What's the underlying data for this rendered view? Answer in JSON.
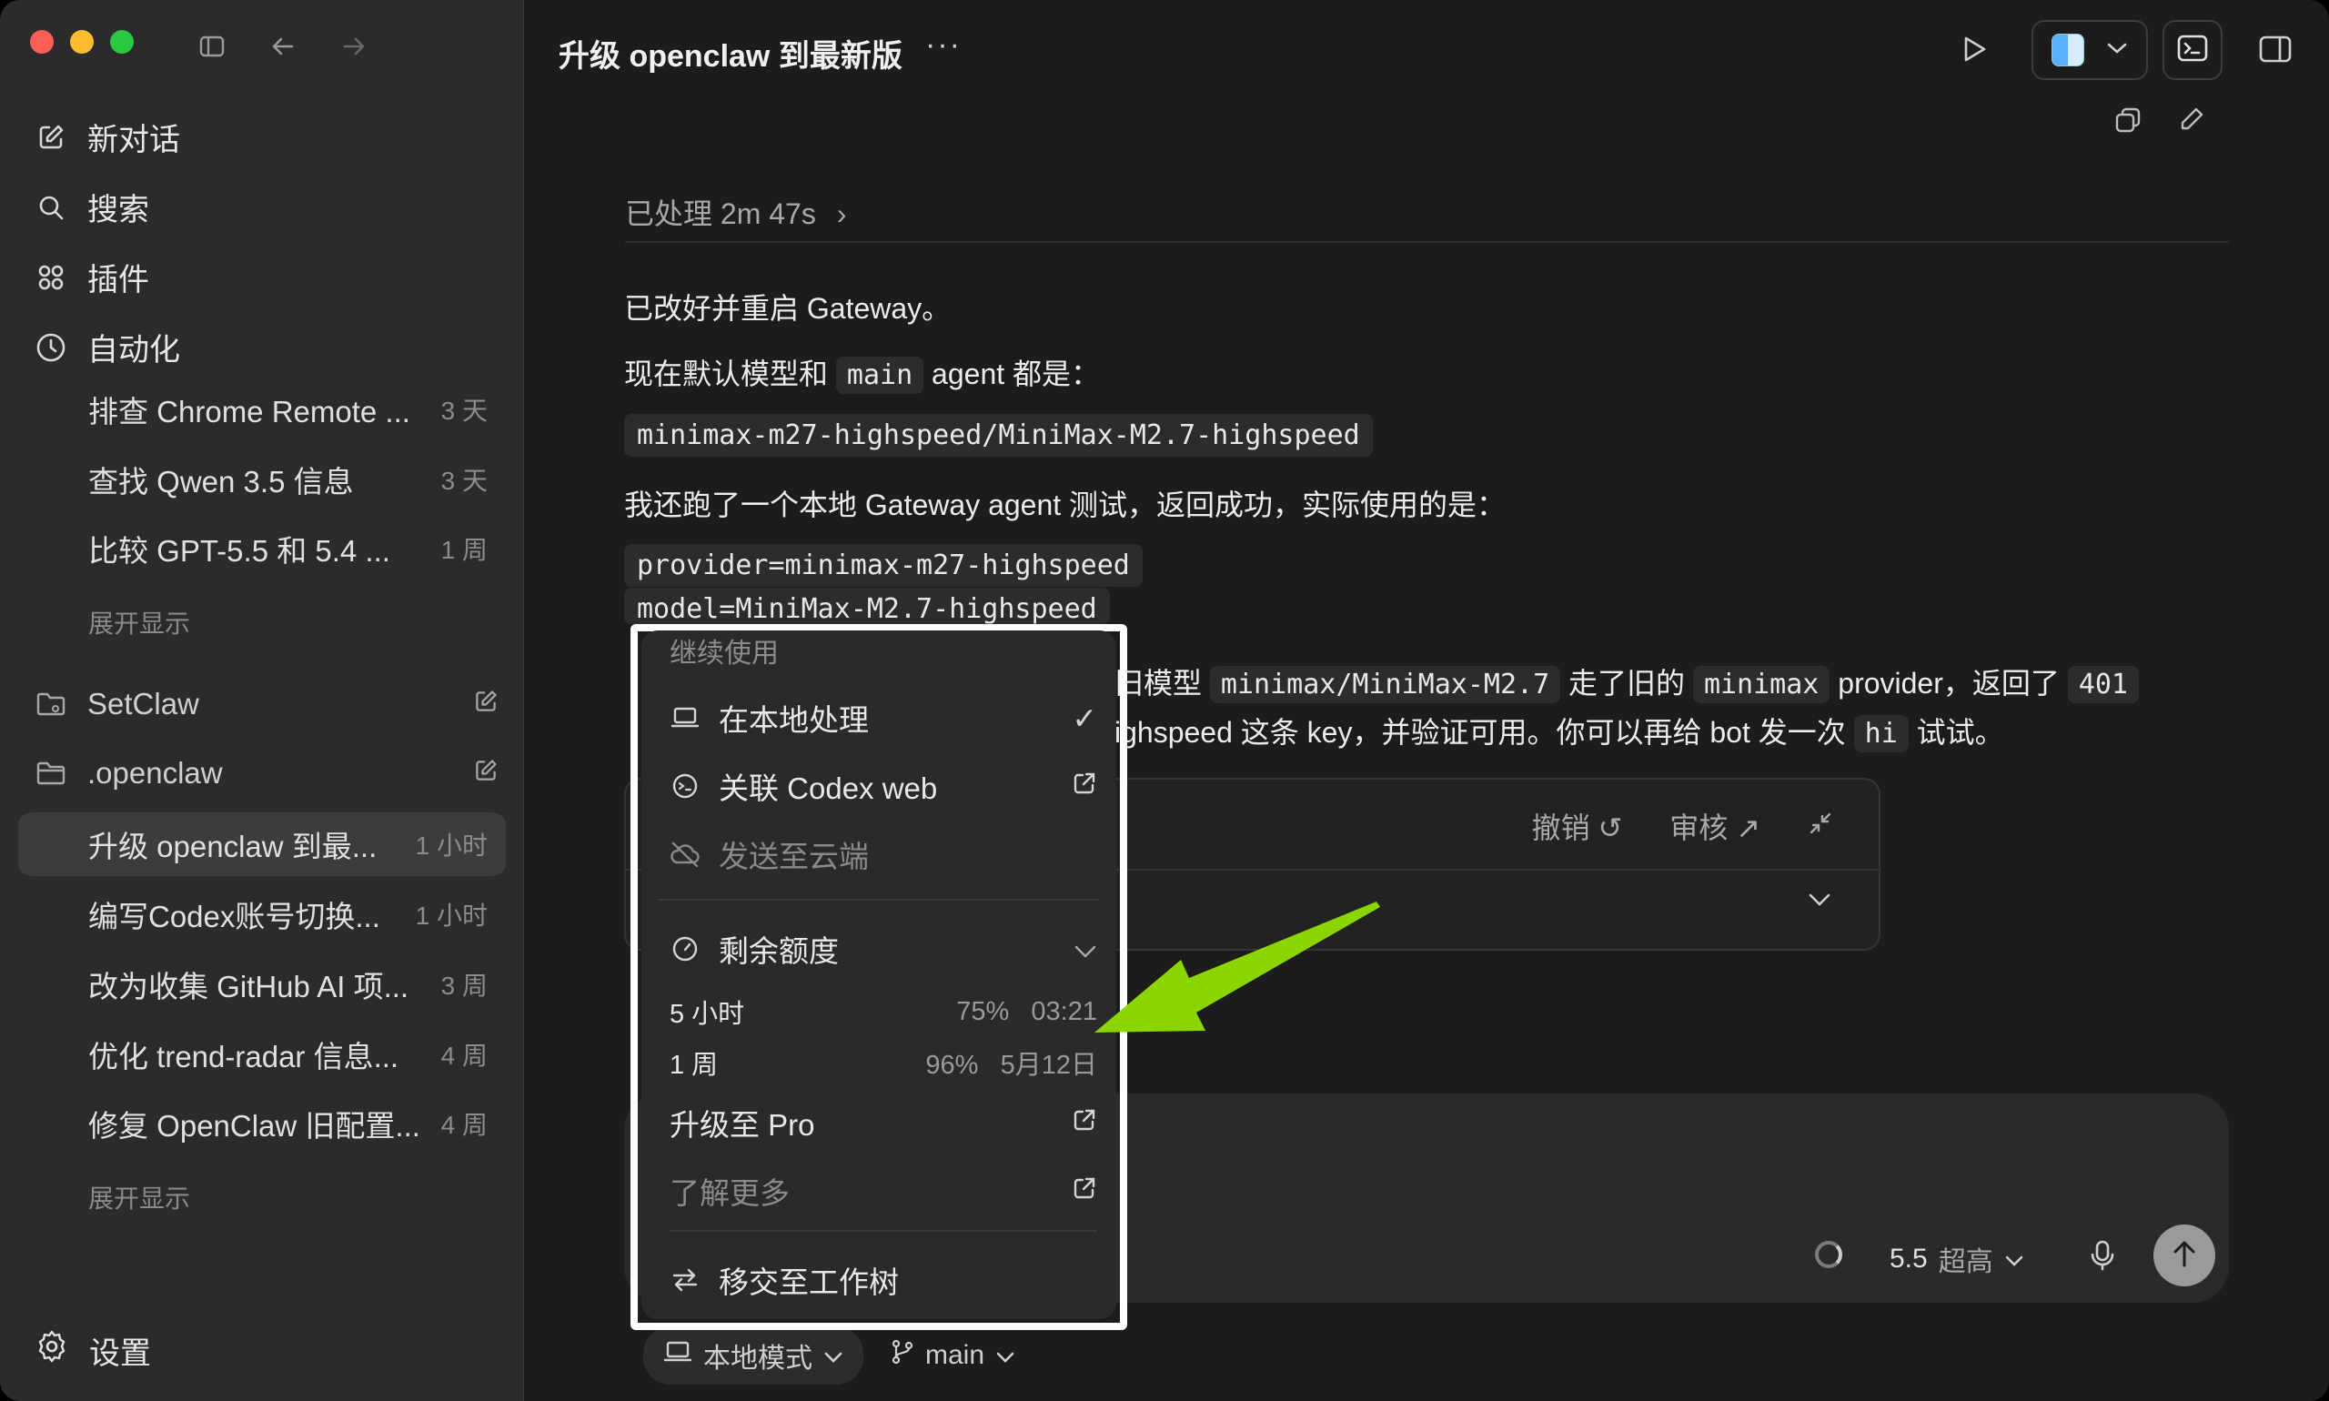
{
  "sidebar": {
    "nav": [
      {
        "label": "新对话",
        "icon": "compose-icon"
      },
      {
        "label": "搜索",
        "icon": "search-icon"
      },
      {
        "label": "插件",
        "icon": "plugins-icon"
      },
      {
        "label": "自动化",
        "icon": "clock-icon"
      }
    ],
    "recent": [
      {
        "title": "排查 Chrome Remote ...",
        "time": "3 天"
      },
      {
        "title": "查找 Qwen 3.5 信息",
        "time": "3 天"
      },
      {
        "title": "比较 GPT-5.5 和 5.4 ...",
        "time": "1 周"
      }
    ],
    "show_more_1": "展开显示",
    "projects": [
      {
        "label": "SetClaw"
      },
      {
        "label": ".openclaw"
      }
    ],
    "threads": [
      {
        "title": "升级 openclaw 到最...",
        "time": "1 小时"
      },
      {
        "title": "编写Codex账号切换...",
        "time": "1 小时"
      },
      {
        "title": "改为收集 GitHub AI 项...",
        "time": "3 周"
      },
      {
        "title": "优化 trend-radar 信息...",
        "time": "4 周"
      },
      {
        "title": "修复 OpenClaw 旧配置...",
        "time": "4 周"
      }
    ],
    "show_more_2": "展开显示",
    "settings": "设置"
  },
  "header": {
    "title": "升级 openclaw 到最新版",
    "more": "···"
  },
  "message": {
    "processed": "已处理 2m 47s",
    "line1": "已改好并重启 Gateway。",
    "line2_pre": "现在默认模型和",
    "line2_code": "main",
    "line2_post": "agent 都是：",
    "code1": "minimax-m27-highspeed/MiniMax-M2.7-highspeed",
    "line3": "我还跑了一个本地 Gateway agent 测试，返回成功，实际使用的是：",
    "code2": "provider=minimax-m27-highspeed",
    "code3": "model=MiniMax-M2.7-highspeed",
    "line4_a": "旧模型",
    "line4_code1": "minimax/MiniMax-M2.7",
    "line4_b": "走了旧的",
    "line4_code2": "minimax",
    "line4_c": "provider，返回了",
    "line4_code3": "401",
    "line5_a": "ighspeed 这条 key，并验证可用。你可以再给 bot 发一次",
    "line5_code": "hi",
    "line5_b": "试试。"
  },
  "review": {
    "undo": "撤销",
    "review": "审核"
  },
  "composer": {
    "model": "5.5",
    "level": "超高"
  },
  "bottom": {
    "mode": "本地模式",
    "branch": "main"
  },
  "popup": {
    "header": "继续使用",
    "items": [
      {
        "label": "在本地处理",
        "icon": "laptop-icon",
        "right": "✓"
      },
      {
        "label": "关联 Codex web",
        "icon": "codex-icon",
        "right": "external-link-icon"
      },
      {
        "label": "发送至云端",
        "icon": "cloud-off-icon"
      }
    ],
    "quota_label": "剩余额度",
    "quotas": [
      {
        "label": "5 小时",
        "percent": "75%",
        "reset": "03:21"
      },
      {
        "label": "1 周",
        "percent": "96%",
        "reset": "5月12日"
      }
    ],
    "upgrade": "升级至 Pro",
    "learn_more": "了解更多",
    "handoff": "移交至工作树"
  },
  "colors": {
    "arrow": "#8bd600",
    "frame": "#ffffff"
  }
}
